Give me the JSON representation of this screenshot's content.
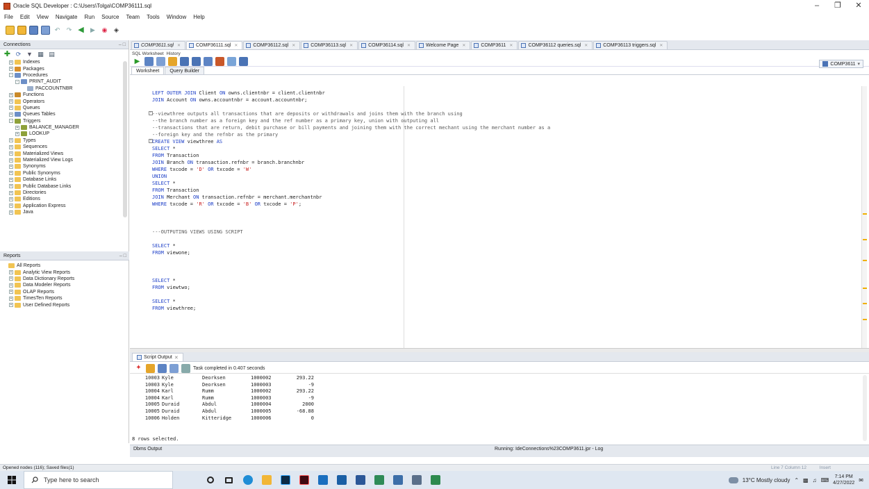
{
  "window": {
    "title": "Oracle SQL Developer : C:\\Users\\Tolga\\COMP36111.sql"
  },
  "menu": [
    "File",
    "Edit",
    "View",
    "Navigate",
    "Run",
    "Source",
    "Team",
    "Tools",
    "Window",
    "Help"
  ],
  "connections_panel": {
    "title": "Connections",
    "tree": [
      {
        "label": "Indexes",
        "level": 1,
        "exp": "+",
        "icon": "folder-icon"
      },
      {
        "label": "Packages",
        "level": 1,
        "exp": "+",
        "icon": "package-icon"
      },
      {
        "label": "Procedures",
        "level": 1,
        "exp": "-",
        "icon": "procedure-icon"
      },
      {
        "label": "PRINT_AUDIT",
        "level": 2,
        "exp": "-",
        "icon": "procedure-icon"
      },
      {
        "label": "PACCOUNTNBR",
        "level": 3,
        "exp": "",
        "icon": "parameter-icon"
      },
      {
        "label": "Functions",
        "level": 1,
        "exp": "+",
        "icon": "function-icon"
      },
      {
        "label": "Operators",
        "level": 1,
        "exp": "+",
        "icon": "folder-icon"
      },
      {
        "label": "Queues",
        "level": 1,
        "exp": "+",
        "icon": "folder-icon"
      },
      {
        "label": "Queues Tables",
        "level": 1,
        "exp": "+",
        "icon": "table-icon"
      },
      {
        "label": "Triggers",
        "level": 1,
        "exp": "-",
        "icon": "trigger-icon"
      },
      {
        "label": "BALANCE_MANAGER",
        "level": 2,
        "exp": "+",
        "icon": "trigger-icon"
      },
      {
        "label": "LOOKUP",
        "level": 2,
        "exp": "+",
        "icon": "trigger-icon"
      },
      {
        "label": "Types",
        "level": 1,
        "exp": "+",
        "icon": "folder-icon"
      },
      {
        "label": "Sequences",
        "level": 1,
        "exp": "+",
        "icon": "folder-icon"
      },
      {
        "label": "Materialized Views",
        "level": 1,
        "exp": "+",
        "icon": "folder-icon"
      },
      {
        "label": "Materialized View Logs",
        "level": 1,
        "exp": "+",
        "icon": "folder-icon"
      },
      {
        "label": "Synonyms",
        "level": 1,
        "exp": "+",
        "icon": "folder-icon"
      },
      {
        "label": "Public Synonyms",
        "level": 1,
        "exp": "+",
        "icon": "folder-icon"
      },
      {
        "label": "Database Links",
        "level": 1,
        "exp": "+",
        "icon": "folder-icon"
      },
      {
        "label": "Public Database Links",
        "level": 1,
        "exp": "+",
        "icon": "folder-icon"
      },
      {
        "label": "Directories",
        "level": 1,
        "exp": "+",
        "icon": "folder-icon"
      },
      {
        "label": "Editions",
        "level": 1,
        "exp": "+",
        "icon": "folder-icon"
      },
      {
        "label": "Application Express",
        "level": 1,
        "exp": "+",
        "icon": "folder-icon"
      },
      {
        "label": "Java",
        "level": 1,
        "exp": "+",
        "icon": "folder-icon"
      }
    ]
  },
  "reports_panel": {
    "title": "Reports",
    "tree": [
      {
        "label": "All Reports",
        "level": 0,
        "exp": ""
      },
      {
        "label": "Analytic View Reports",
        "level": 1,
        "exp": "+"
      },
      {
        "label": "Data Dictionary Reports",
        "level": 1,
        "exp": "+"
      },
      {
        "label": "Data Modeler Reports",
        "level": 1,
        "exp": "+"
      },
      {
        "label": "OLAP Reports",
        "level": 1,
        "exp": "+"
      },
      {
        "label": "TimesTen Reports",
        "level": 1,
        "exp": "+"
      },
      {
        "label": "User Defined Reports",
        "level": 1,
        "exp": "+"
      }
    ]
  },
  "editor_tabs": [
    {
      "label": "COMP3611.sql",
      "active": false
    },
    {
      "label": "COMP36111.sql",
      "active": true
    },
    {
      "label": "COMP36112.sql",
      "active": false
    },
    {
      "label": "COMP36113.sql",
      "active": false
    },
    {
      "label": "COMP36114.sql",
      "active": false
    },
    {
      "label": "Welcome Page",
      "active": false
    },
    {
      "label": "COMP3611",
      "active": false
    },
    {
      "label": "COMP36112 queries.sql",
      "active": false
    },
    {
      "label": "COMP36113 triggers.sql",
      "active": false
    }
  ],
  "editor": {
    "subtabs": [
      "SQL Worksheet",
      "History"
    ],
    "worksheet_tabs": [
      "Worksheet",
      "Query Builder"
    ],
    "connection": "COMP3611",
    "lines": [
      "LEFT OUTER JOIN Client ON owns.clientnbr = client.clientnbr",
      "JOIN Account ON owns.accountnbr = account.accountnbr;",
      "",
      "--viewthree outputs all transactions that are deposits or withdrawals and joins them with the branch using",
      "--the branch number as a foreign key and the ref number as a primary key, union with outputing all",
      "--transactions that are return, debit purchase or bill payments and joining them with the correct mechant using the merchant number as a",
      "--foreign key and the refnbr as the primary",
      "CREATE VIEW viewthree AS",
      "SELECT *",
      "FROM Transaction",
      "JOIN Branch ON transaction.refnbr = branch.branchnbr",
      "WHERE txcode = 'D' OR txcode = 'W'",
      "UNION",
      "SELECT *",
      "FROM Transaction",
      "JOIN Merchant ON transaction.refnbr = merchant.merchantnbr",
      "WHERE txcode = 'R' OR txcode = 'B' OR txcode = 'P';",
      "",
      "",
      "",
      "---OUTPUTING VIEWS USING SCRIPT",
      "",
      "SELECT *",
      "FROM viewone;",
      "",
      "",
      "",
      "SELECT *",
      "FROM viewtwo;",
      "",
      "SELECT *",
      "FROM viewthree;"
    ]
  },
  "script_output": {
    "tab": "Script Output",
    "status": "Task completed in 0.407 seconds",
    "rows": [
      [
        "10003",
        "Kyle",
        "Deorksen",
        "1000002",
        "293.22"
      ],
      [
        "10003",
        "Kyle",
        "Deorksen",
        "1000003",
        "-9"
      ],
      [
        "10004",
        "Karl",
        "Rumm",
        "1000002",
        "293.22"
      ],
      [
        "10004",
        "Karl",
        "Rumm",
        "1000003",
        "-9"
      ],
      [
        "10005",
        "Duraid",
        "Abdul",
        "1000004",
        "2000"
      ],
      [
        "10005",
        "Duraid",
        "Abdul",
        "1000005",
        "-68.88"
      ],
      [
        "10006",
        "Holden",
        "Kitteridge",
        "1000006",
        "0"
      ]
    ],
    "summary": "8 rows selected."
  },
  "bottom_panels": {
    "dbms": "Dbms Output",
    "log": "Running: IdeConnections%23COMP3611.jpr - Log"
  },
  "statusbar": {
    "left": "Opened nodes (116); Saved files(1)",
    "position": "Line 7 Column 12",
    "mode": "Insert"
  },
  "taskbar": {
    "search_placeholder": "Type here to search",
    "weather": "13°C Mostly cloudy",
    "time": "7:14 PM",
    "date": "4/27/2022"
  }
}
